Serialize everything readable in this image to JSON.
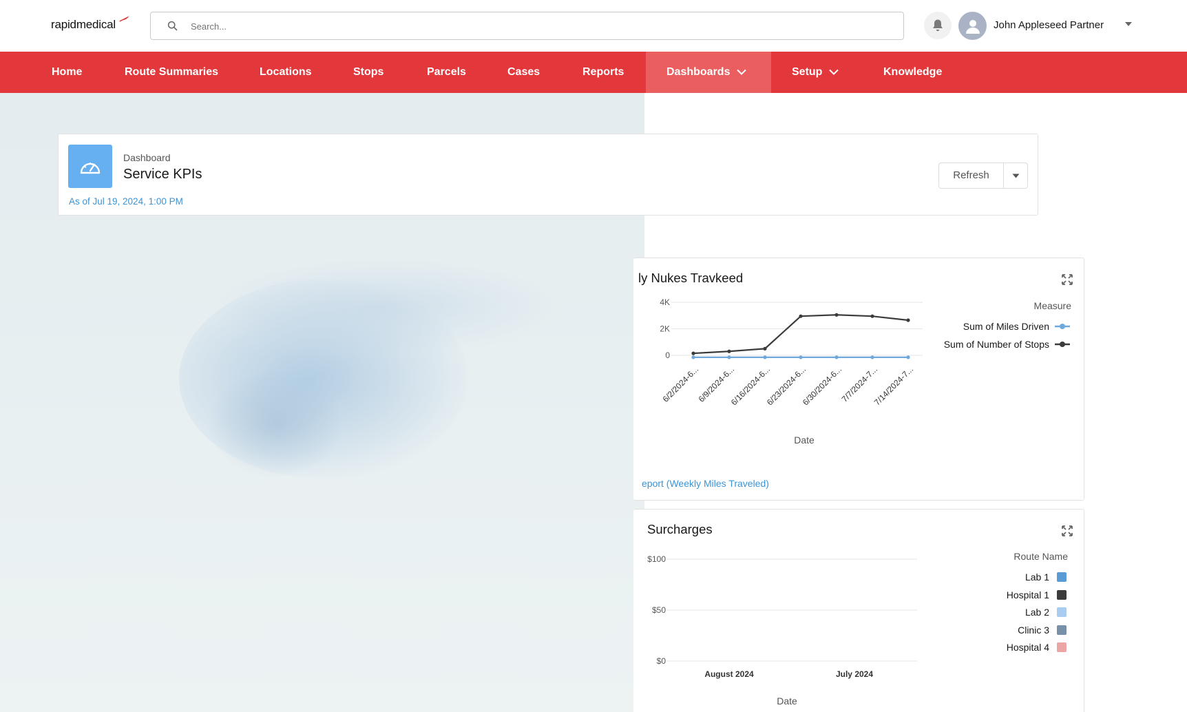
{
  "app": {
    "logo_bold": "rapid",
    "logo_rest": "medical",
    "brand_color": "#e2373b"
  },
  "header": {
    "search_placeholder": "Search...",
    "user_name": "John Appleseed Partner"
  },
  "nav": {
    "items": [
      {
        "label": "Home",
        "active": false,
        "has_menu": false
      },
      {
        "label": "Route Summaries",
        "active": false,
        "has_menu": false
      },
      {
        "label": "Locations",
        "active": false,
        "has_menu": false
      },
      {
        "label": "Stops",
        "active": false,
        "has_menu": false
      },
      {
        "label": "Parcels",
        "active": false,
        "has_menu": false
      },
      {
        "label": "Cases",
        "active": false,
        "has_menu": false
      },
      {
        "label": "Reports",
        "active": false,
        "has_menu": false
      },
      {
        "label": "Dashboards",
        "active": true,
        "has_menu": true
      },
      {
        "label": "Setup",
        "active": false,
        "has_menu": true
      },
      {
        "label": "Knowledge",
        "active": false,
        "has_menu": false
      }
    ]
  },
  "dashboard": {
    "kicker": "Dashboard",
    "title": "Service KPIs",
    "as_of": "As of Jul 19, 2024, 1:00 PM",
    "refresh_label": "Refresh",
    "icon": "speedometer-icon"
  },
  "widget_miles": {
    "title": "ly Nukes Travkeed",
    "link": "eport (Weekly Miles Traveled)",
    "legend_title": "Measure",
    "xlabel": "Date"
  },
  "widget_surcharges": {
    "title": "Surcharges",
    "legend_title": "Route Name",
    "xlabel": "Date"
  },
  "chart_data": [
    {
      "type": "line",
      "title": "ly Nukes Travkeed",
      "xlabel": "Date",
      "ylabel": "",
      "categories": [
        "6/2/2024-6...",
        "6/9/2024-6...",
        "6/16/2024-6...",
        "6/23/2024-6...",
        "6/30/2024-6...",
        "7/7/2024-7...",
        "7/14/2024-7..."
      ],
      "yticks": [
        {
          "value": 0,
          "label": "0"
        },
        {
          "value": 2000,
          "label": "2K"
        },
        {
          "value": 4000,
          "label": "4K"
        }
      ],
      "ylim": [
        -400,
        4000
      ],
      "series": [
        {
          "name": "Sum of Miles Driven",
          "color": "#6fa8dc",
          "values": [
            -150,
            -150,
            -150,
            -150,
            -150,
            -150,
            -150
          ]
        },
        {
          "name": "Sum of Number of Stops",
          "color": "#3b3b3b",
          "values": [
            150,
            300,
            500,
            2950,
            3050,
            2950,
            2650
          ]
        }
      ],
      "legend_position": "right",
      "grid": true
    },
    {
      "type": "bar",
      "title": "Surcharges",
      "xlabel": "Date",
      "categories": [
        "August 2024",
        "July 2024"
      ],
      "yticks": [
        {
          "value": 0,
          "label": "$0"
        },
        {
          "value": 50,
          "label": "$50"
        },
        {
          "value": 100,
          "label": "$100"
        }
      ],
      "ylim": [
        0,
        100
      ],
      "series": [
        {
          "name": "Lab 1",
          "color": "#5b9bd5",
          "values": [
            0,
            0
          ]
        },
        {
          "name": "Hospital 1",
          "color": "#3b3b3b",
          "values": [
            0,
            0
          ]
        },
        {
          "name": "Lab 2",
          "color": "#a9cdf0",
          "values": [
            0,
            0
          ]
        },
        {
          "name": "Clinic 3",
          "color": "#7890a8",
          "values": [
            0,
            0
          ]
        },
        {
          "name": "Hospital 4",
          "color": "#eba5a5",
          "values": [
            0,
            0
          ]
        }
      ],
      "legend_position": "right",
      "grid": true
    }
  ]
}
